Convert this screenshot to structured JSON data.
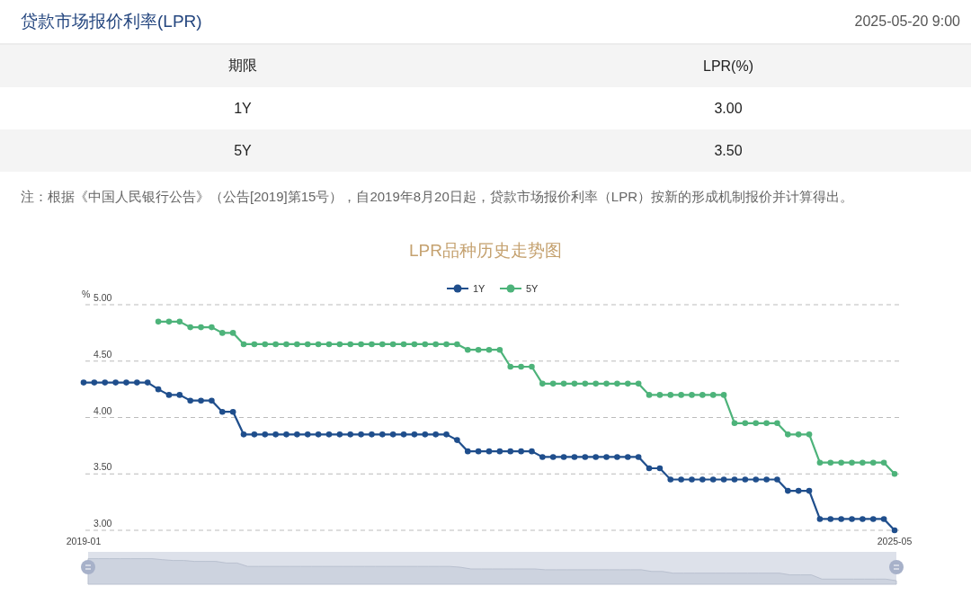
{
  "header": {
    "title": "贷款市场报价利率(LPR)",
    "timestamp": "2025-05-20 9:00"
  },
  "table": {
    "columns": [
      "期限",
      "LPR(%)"
    ],
    "rows": [
      [
        "1Y",
        "3.00"
      ],
      [
        "5Y",
        "3.50"
      ]
    ]
  },
  "note": "注：根据《中国人民银行公告》（公告[2019]第15号），自2019年8月20日起，贷款市场报价利率（LPR）按新的形成机制报价并计算得出。",
  "chart": {
    "chart_data": {
      "type": "line",
      "title": "LPR品种历史走势图",
      "ylabel": "%",
      "categories": [
        "2019-01",
        null,
        null,
        null,
        null,
        null,
        null,
        null,
        null,
        null,
        null,
        null,
        null,
        null,
        null,
        null,
        null,
        null,
        null,
        null,
        null,
        null,
        null,
        null,
        null,
        null,
        null,
        null,
        null,
        null,
        null,
        null,
        null,
        null,
        null,
        null,
        null,
        null,
        null,
        null,
        null,
        null,
        null,
        null,
        null,
        null,
        null,
        null,
        null,
        null,
        null,
        null,
        null,
        null,
        null,
        null,
        null,
        null,
        null,
        null,
        null,
        null,
        null,
        null,
        null,
        null,
        null,
        null,
        null,
        null,
        null,
        null,
        null,
        null,
        null,
        null,
        "2025-05"
      ],
      "grid": true,
      "legend": true,
      "series": [
        {
          "name": "1Y",
          "color": "#1f4e8c",
          "marker": "circle",
          "values": [
            4.31,
            4.31,
            4.31,
            4.31,
            4.31,
            4.31,
            4.31,
            4.25,
            4.2,
            4.2,
            4.15,
            4.15,
            4.15,
            4.05,
            4.05,
            3.85,
            3.85,
            3.85,
            3.85,
            3.85,
            3.85,
            3.85,
            3.85,
            3.85,
            3.85,
            3.85,
            3.85,
            3.85,
            3.85,
            3.85,
            3.85,
            3.85,
            3.85,
            3.85,
            3.85,
            3.8,
            3.7,
            3.7,
            3.7,
            3.7,
            3.7,
            3.7,
            3.7,
            3.65,
            3.65,
            3.65,
            3.65,
            3.65,
            3.65,
            3.65,
            3.65,
            3.65,
            3.65,
            3.55,
            3.55,
            3.45,
            3.45,
            3.45,
            3.45,
            3.45,
            3.45,
            3.45,
            3.45,
            3.45,
            3.45,
            3.45,
            3.35,
            3.35,
            3.35,
            3.1,
            3.1,
            3.1,
            3.1,
            3.1,
            3.1,
            3.1,
            3.0
          ]
        },
        {
          "name": "5Y",
          "color": "#4db37a",
          "marker": "circle",
          "values": [
            null,
            null,
            null,
            null,
            null,
            null,
            null,
            4.85,
            4.85,
            4.85,
            4.8,
            4.8,
            4.8,
            4.75,
            4.75,
            4.65,
            4.65,
            4.65,
            4.65,
            4.65,
            4.65,
            4.65,
            4.65,
            4.65,
            4.65,
            4.65,
            4.65,
            4.65,
            4.65,
            4.65,
            4.65,
            4.65,
            4.65,
            4.65,
            4.65,
            4.65,
            4.6,
            4.6,
            4.6,
            4.6,
            4.45,
            4.45,
            4.45,
            4.3,
            4.3,
            4.3,
            4.3,
            4.3,
            4.3,
            4.3,
            4.3,
            4.3,
            4.3,
            4.2,
            4.2,
            4.2,
            4.2,
            4.2,
            4.2,
            4.2,
            4.2,
            3.95,
            3.95,
            3.95,
            3.95,
            3.95,
            3.85,
            3.85,
            3.85,
            3.6,
            3.6,
            3.6,
            3.6,
            3.6,
            3.6,
            3.6,
            3.5
          ]
        }
      ],
      "ylim": [
        3,
        5
      ],
      "yticks": [
        {
          "value": 3,
          "label": "3.00"
        },
        {
          "value": 3.5,
          "label": "3.50"
        },
        {
          "value": 4,
          "label": "4.00"
        },
        {
          "value": 4.5,
          "label": "4.50"
        },
        {
          "value": 5,
          "label": "5.00"
        }
      ]
    }
  }
}
